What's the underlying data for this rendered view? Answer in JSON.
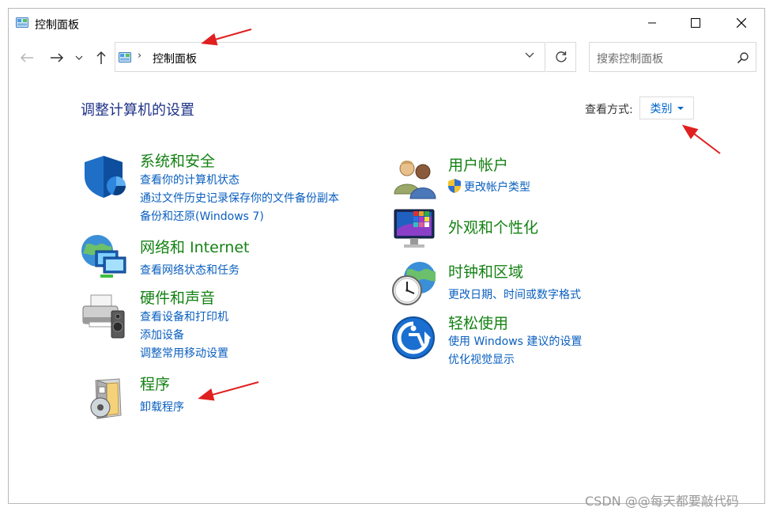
{
  "window": {
    "title": "控制面板",
    "controls": {
      "minimize": "minimize",
      "maximize": "maximize",
      "close": "close"
    }
  },
  "address": {
    "path": "控制面板",
    "separator": "›",
    "search_placeholder": "搜索控制面板"
  },
  "content": {
    "heading": "调整计算机的设置",
    "view_by_label": "查看方式:",
    "view_by_value": "类别"
  },
  "categories_left": [
    {
      "title": "系统和安全",
      "links": [
        "查看你的计算机状态",
        "通过文件历史记录保存你的文件备份副本",
        "备份和还原(Windows 7)"
      ]
    },
    {
      "title": "网络和 Internet",
      "links": [
        "查看网络状态和任务"
      ]
    },
    {
      "title": "硬件和声音",
      "links": [
        "查看设备和打印机",
        "添加设备",
        "调整常用移动设置"
      ]
    },
    {
      "title": "程序",
      "links": [
        "卸载程序"
      ]
    }
  ],
  "categories_right": [
    {
      "title": "用户帐户",
      "links": [
        "更改帐户类型"
      ]
    },
    {
      "title": "外观和个性化",
      "links": []
    },
    {
      "title": "时钟和区域",
      "links": [
        "更改日期、时间或数字格式"
      ]
    },
    {
      "title": "轻松使用",
      "links": [
        "使用 Windows 建议的设置",
        "优化视觉显示"
      ]
    }
  ],
  "watermark": "CSDN @@每天都要敲代码",
  "colors": {
    "heading": "#1e3287",
    "category_title": "#148214",
    "link": "#0a5fbf",
    "annotation_arrow": "#e02020"
  },
  "icons": {
    "title": "control-panel-icon",
    "back": "arrow-left-icon",
    "forward": "arrow-right-icon",
    "recent": "chevron-down-icon",
    "up": "arrow-up-icon",
    "refresh": "refresh-icon",
    "search": "search-icon"
  }
}
